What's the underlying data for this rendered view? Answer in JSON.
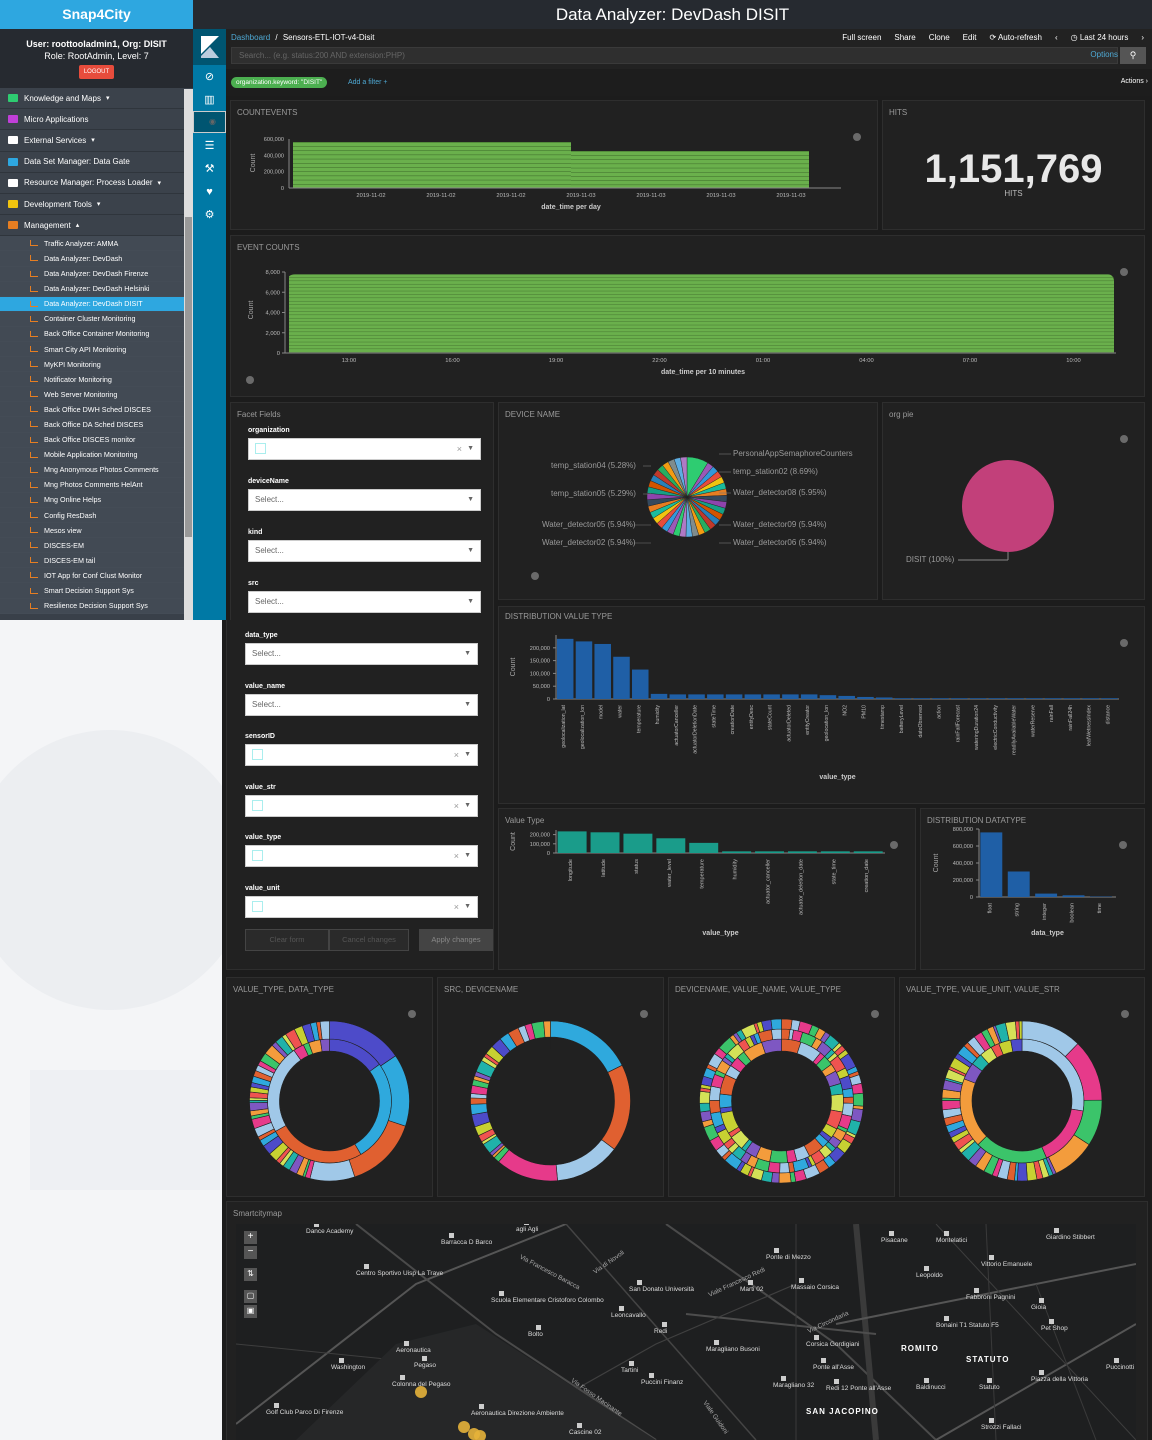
{
  "app": {
    "brand": "Snap4City",
    "title": "Data Analyzer: DevDash DISIT"
  },
  "user": {
    "line1": "User: roottooladmin1, Org: DISIT",
    "line2": "Role: RootAdmin, Level: 7",
    "logout": "LOGOUT"
  },
  "menu": [
    {
      "label": "Knowledge and Maps",
      "caret": "▾",
      "color": "#2ecc71"
    },
    {
      "label": "Micro Applications",
      "caret": "",
      "color": "#c03fd8"
    },
    {
      "label": "External Services",
      "caret": "▾",
      "color": "#ffffff"
    },
    {
      "label": "Data Set Manager: Data Gate",
      "caret": "",
      "color": "#2ea7e0"
    },
    {
      "label": "Resource Manager: Process Loader",
      "caret": "▾",
      "color": "#ffffff"
    },
    {
      "label": "Development Tools",
      "caret": "▾",
      "color": "#f1c40f"
    },
    {
      "label": "Management",
      "caret": "▴",
      "color": "#e67e22"
    }
  ],
  "submenu": [
    "Traffic Analyzer: AMMA",
    "Data Analyzer: DevDash",
    "Data Analyzer: DevDash Firenze",
    "Data Analyzer: DevDash Helsinki",
    "Data Analyzer: DevDash DISIT",
    "Container Cluster Monitoring",
    "Back Office Container Monitoring",
    "Smart City API Monitoring",
    "MyKPI Monitoring",
    "Notificator Monitoring",
    "Web Server Monitoring",
    "Back Office DWH Sched DISCES",
    "Back Office DA Sched DISCES",
    "Back Office DISCES monitor",
    "Mobile Application Monitoring",
    "Mng Anonymous Photos Comments",
    "Mng Photos Comments HelAnt",
    "Mng Online Helps",
    "Config ResDash",
    "Mesos view",
    "DISCES-EM",
    "DISCES-EM tail",
    "IOT App for Conf Clust Monitor",
    "Smart Decision Support Sys",
    "Resilience Decision Support Sys"
  ],
  "active_submenu_index": 4,
  "kibana": {
    "crumb_root": "Dashboard",
    "crumb_sep": "/",
    "crumb_current": "Sensors-ETL-IOT-v4-Disit",
    "links": [
      "Full screen",
      "Share",
      "Clone",
      "Edit",
      "⟳ Auto-refresh",
      "‹",
      "◷ Last 24 hours",
      "›"
    ],
    "search_placeholder": "Search... (e.g. status:200 AND extension:PHP)",
    "options": "Options",
    "filter_pill": "organization.keyword: \"DISIT\"",
    "add_filter": "Add a filter +",
    "actions": "Actions ›"
  },
  "panels": {
    "countevents": "COUNTEVENTS",
    "hits": "HITS",
    "event_counts": "EVENT COUNTS",
    "facet": "Facet Fields",
    "device_name": "DEVICE NAME",
    "org_pie": "org pie",
    "dist_value_type": "DISTRIBUTION VALUE TYPE",
    "value_type": "Value Type",
    "dist_datatype": "DISTRIBUTION DATATYPE",
    "d1": "VALUE_TYPE, DATA_TYPE",
    "d2": "SRC, DEVICENAME",
    "d3": "DEVICENAME, VALUE_NAME, VALUE_TYPE",
    "d4": "VALUE_TYPE, VALUE_UNIT, VALUE_STR",
    "map": "Smartcitymap"
  },
  "hits": {
    "value": "1,151,769",
    "label": "HITS"
  },
  "facets": {
    "fields": [
      {
        "label": "organization",
        "type": "tag"
      },
      {
        "label": "deviceName",
        "type": "select"
      },
      {
        "label": "kind",
        "type": "select"
      },
      {
        "label": "src",
        "type": "select"
      },
      {
        "label": "data_type",
        "type": "select"
      },
      {
        "label": "value_name",
        "type": "select"
      },
      {
        "label": "sensorID",
        "type": "tag"
      },
      {
        "label": "value_str",
        "type": "tag"
      },
      {
        "label": "value_type",
        "type": "tag"
      },
      {
        "label": "value_unit",
        "type": "tag"
      }
    ],
    "select_placeholder": "Select...",
    "clear": "Clear form",
    "cancel": "Cancel changes",
    "apply": "Apply changes"
  },
  "chart_data": [
    {
      "type": "bar",
      "id": "countevents",
      "color": "#6ab04c",
      "xlabel": "date_time per day",
      "ylabel": "Count",
      "ylim": [
        0,
        600000
      ],
      "yticks": [
        "600,000",
        "400,000",
        "200,000",
        "0"
      ],
      "x_ticks": [
        "2019-11-02",
        "2019-11-02",
        "2019-11-02",
        "2019-11-03",
        "2019-11-03",
        "2019-11-03",
        "2019-11-03"
      ],
      "series": [
        {
          "x": [
            "2019-11-02",
            "2019-11-03"
          ],
          "values": [
            560000,
            450000
          ]
        }
      ]
    },
    {
      "type": "bar",
      "id": "event_counts",
      "color": "#6ab04c",
      "xlabel": "date_time per 10 minutes",
      "ylabel": "Count",
      "ylim": [
        0,
        8000
      ],
      "yticks": [
        "8,000",
        "6,000",
        "4,000",
        "2,000",
        "0"
      ],
      "x_ticks": [
        "13:00",
        "16:00",
        "19:00",
        "22:00",
        "01:00",
        "04:00",
        "07:00",
        "10:00"
      ],
      "level": 8000
    },
    {
      "type": "pie",
      "id": "device_name",
      "labels_left": [
        "temp_station04 (5.28%)",
        "temp_station05 (5.29%)",
        "Water_detector05 (5.94%)",
        "Water_detector02 (5.94%)"
      ],
      "labels_right": [
        "PersonalAppSemaphoreCounters",
        "temp_station02 (8.69%)",
        "Water_detector08 (5.95%)",
        "Water_detector09 (5.94%)",
        "Water_detector06 (5.94%)"
      ]
    },
    {
      "type": "pie",
      "id": "org_pie",
      "labels": [
        "DISIT (100%)"
      ],
      "values": [
        100
      ],
      "color": "#c2407a"
    },
    {
      "type": "bar",
      "id": "dist_value_type",
      "color": "#1f5fa6",
      "xlabel": "value_type",
      "ylabel": "Count",
      "ylim": [
        0,
        250000
      ],
      "yticks": [
        "200,000",
        "150,000",
        "100,000",
        "50,000",
        "0"
      ],
      "categories": [
        "geolocalization_lat",
        "geolocalization_lon",
        "model",
        "water",
        "temperature",
        "humidity",
        "actuatorCanceller",
        "actuatorDeletionDate",
        "stateTime",
        "creationDate",
        "entityDesc",
        "stateCount",
        "actuatorDeleted",
        "entityCreator",
        "geolocation_lon",
        "NO2",
        "PM10",
        "timestamp",
        "batteryLevel",
        "datoObserved",
        "action",
        "rainFallForecast",
        "wateringDuration24",
        "electricConductivity",
        "readilyAvailableWater",
        "waterReserve",
        "rainFall",
        "rainFall24h",
        "leafWetnessIndex",
        "distance"
      ],
      "values": [
        235000,
        225000,
        215000,
        165000,
        115000,
        20000,
        18000,
        18000,
        18000,
        18000,
        18000,
        18000,
        18000,
        18000,
        15000,
        12000,
        8000,
        6000,
        3000,
        3000,
        3000,
        3000,
        3000,
        3000,
        3000,
        3000,
        3000,
        3000,
        3000,
        3000
      ]
    },
    {
      "type": "bar",
      "id": "value_type",
      "color": "#1a9c8a",
      "xlabel": "value_type",
      "ylabel": "Count",
      "ylim": [
        0,
        250000
      ],
      "yticks": [
        "200,000",
        "100,000",
        "0"
      ],
      "categories": [
        "longitude",
        "latitude",
        "status",
        "water_level",
        "temperature",
        "humidity",
        "actuator_canceller",
        "actuator_deletion_date",
        "state_time",
        "creation_date"
      ],
      "values": [
        235000,
        225000,
        210000,
        160000,
        110000,
        18000,
        18000,
        18000,
        18000,
        18000
      ]
    },
    {
      "type": "bar",
      "id": "dist_datatype",
      "color": "#1f5fa6",
      "xlabel": "data_type",
      "ylabel": "Count",
      "ylim": [
        0,
        800000
      ],
      "yticks": [
        "800,000",
        "600,000",
        "400,000",
        "200,000",
        "0"
      ],
      "categories": [
        "float",
        "string",
        "integer",
        "boolean",
        "time"
      ],
      "values": [
        760000,
        300000,
        40000,
        20000,
        5000
      ]
    }
  ],
  "map": {
    "labels": [
      "Dance Academy",
      "Barracca D Barco",
      "agli Agli",
      "Centro Sportivo Uisp La Trave",
      "Scuola Elementare Cristoforo Colombo",
      "San Donato Università",
      "Marti 02",
      "Massaio Corsica",
      "Ponte di Mezzo",
      "Pisacane",
      "Montelatici",
      "Giardino Stibbert",
      "Leopoldo",
      "Vittorio Emanuele",
      "Fabbroni Pagnini",
      "Gioia",
      "Bonaini T1 Statuto F5",
      "Pet Shop",
      "Leoncavallo",
      "Redi",
      "Bolto",
      "Aeronautica",
      "Pegaso",
      "Washington",
      "Colonna del Pegaso",
      "Golf Club Parco Di Firenze",
      "Aeronautica Direzione Ambiente",
      "Cascine 02",
      "Tartini",
      "Puccini Finanz",
      "Maragliano Busoni",
      "Corsica Gordigiani",
      "Ponte all'Asse",
      "Maragliano 32",
      "Redi 12 Ponte all'Asse",
      "Baldinucci",
      "Statuto",
      "Piazza della Vittoria",
      "Puccinotti",
      "Strozzi Fallaci"
    ],
    "districts": [
      "ROMITO",
      "STATUTO",
      "SAN JACOPINO"
    ],
    "streets": [
      "Via di Novoli",
      "Via Francesco Baracca",
      "Viale Francesco Redi",
      "Via Circondaria",
      "Via Fosso Macinante",
      "Viale Guidoni"
    ]
  }
}
